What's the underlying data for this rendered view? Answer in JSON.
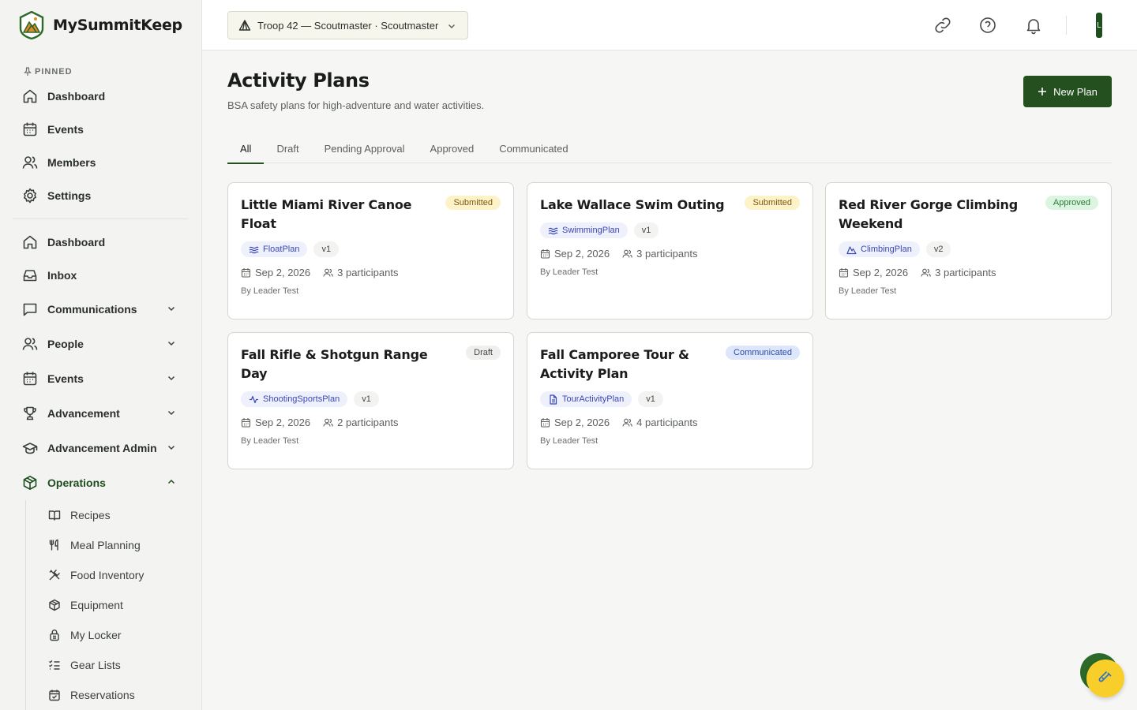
{
  "brand": {
    "name": "MySummitKeep"
  },
  "sidebar": {
    "pinned_label": "PINNED",
    "pinned": [
      {
        "label": "Dashboard",
        "icon": "home-icon"
      },
      {
        "label": "Events",
        "icon": "calendar-icon"
      },
      {
        "label": "Members",
        "icon": "users-icon"
      },
      {
        "label": "Settings",
        "icon": "gear-icon"
      }
    ],
    "items": [
      {
        "label": "Dashboard",
        "icon": "home-icon"
      },
      {
        "label": "Inbox",
        "icon": "inbox-icon"
      },
      {
        "label": "Communications",
        "icon": "message-icon",
        "expandable": true
      },
      {
        "label": "People",
        "icon": "users-icon",
        "expandable": true
      },
      {
        "label": "Events",
        "icon": "calendar-icon",
        "expandable": true
      },
      {
        "label": "Advancement",
        "icon": "trophy-icon",
        "expandable": true
      },
      {
        "label": "Advancement Admin",
        "icon": "graduation-cap-icon",
        "expandable": true
      },
      {
        "label": "Operations",
        "icon": "box-icon",
        "expandable": true,
        "expanded": true
      }
    ],
    "operations_sub": [
      {
        "label": "Recipes",
        "icon": "book-icon"
      },
      {
        "label": "Meal Planning",
        "icon": "utensils-icon"
      },
      {
        "label": "Food Inventory",
        "icon": "utensils-crossed-icon"
      },
      {
        "label": "Equipment",
        "icon": "package-icon"
      },
      {
        "label": "My Locker",
        "icon": "lock-icon"
      },
      {
        "label": "Gear Lists",
        "icon": "checklist-icon"
      },
      {
        "label": "Reservations",
        "icon": "calendar-check-icon"
      }
    ]
  },
  "header": {
    "troop_select": "Troop 42 — Scoutmaster · Scoutmaster",
    "avatar_initial": "L",
    "icons": [
      "checklist-icon",
      "link-icon",
      "help-icon",
      "bell-icon"
    ]
  },
  "page": {
    "title": "Activity Plans",
    "subtitle": "BSA safety plans for high-adventure and water activities.",
    "new_button": "New Plan",
    "tabs": [
      "All",
      "Draft",
      "Pending Approval",
      "Approved",
      "Communicated"
    ],
    "active_tab": "All"
  },
  "plans": [
    {
      "title": "Little Miami River Canoe Float",
      "status": "Submitted",
      "type": "FloatPlan",
      "type_icon": "waves-icon",
      "version": "v1",
      "date": "Sep 2, 2026",
      "participants": "3 participants",
      "author": "By Leader Test"
    },
    {
      "title": "Lake Wallace Swim Outing",
      "status": "Submitted",
      "type": "SwimmingPlan",
      "type_icon": "waves-icon",
      "version": "v1",
      "date": "Sep 2, 2026",
      "participants": "3 participants",
      "author": "By Leader Test"
    },
    {
      "title": "Red River Gorge Climbing Weekend",
      "status": "Approved",
      "type": "ClimbingPlan",
      "type_icon": "mountain-icon",
      "version": "v2",
      "date": "Sep 2, 2026",
      "participants": "3 participants",
      "author": "By Leader Test"
    },
    {
      "title": "Fall Rifle & Shotgun Range Day",
      "status": "Draft",
      "type": "ShootingSportsPlan",
      "type_icon": "activity-icon",
      "version": "v1",
      "date": "Sep 2, 2026",
      "participants": "2 participants",
      "author": "By Leader Test"
    },
    {
      "title": "Fall Camporee Tour & Activity Plan",
      "status": "Communicated",
      "type": "TourActivityPlan",
      "type_icon": "file-icon",
      "version": "v1",
      "date": "Sep 2, 2026",
      "participants": "4 participants",
      "author": "By Leader Test"
    }
  ],
  "colors": {
    "brand_green": "#24501f",
    "accent_yellow": "#f8cf2a"
  }
}
